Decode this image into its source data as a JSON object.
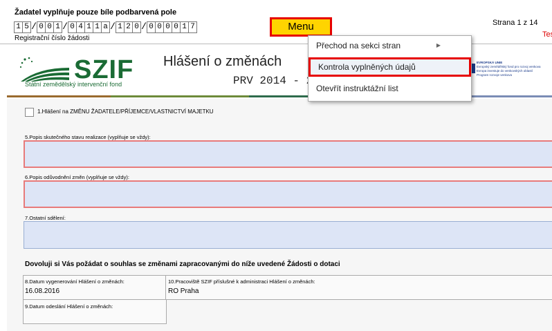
{
  "header": {
    "instruction": "Žadatel vyplňuje pouze bíle podbarvená pole",
    "reg_digits": [
      "1",
      "5",
      "/",
      "0",
      "0",
      "1",
      "/",
      "0",
      "4",
      "1",
      "1",
      "a",
      "/",
      "1",
      "2",
      "0",
      "/",
      "0",
      "0",
      "0",
      "0",
      "1",
      "7"
    ],
    "reg_label": "Registrační číslo žádosti",
    "menu_label": "Menu",
    "page_info": "Strana 1 z 14",
    "test_label": "Test"
  },
  "logo": {
    "name": "SZIF",
    "subtitle": "Státní zemědělský intervenční fond"
  },
  "form_title": "Hlášení o změnách",
  "form_subtitle": "PRV 2014 - 2",
  "eu_badge": {
    "line1": "EVROPSKÁ UNIE",
    "line2": "Evropský zemědělský fond pro rozvoj venkova",
    "line3": "Evropa investuje do venkovských oblastí",
    "line4": "Program rozvoje venkova"
  },
  "dropdown": {
    "items": [
      "Přechod na sekci stran",
      "Kontrola vyplněných údajů",
      "Otevřít instruktážní list"
    ]
  },
  "form": {
    "checkbox_label": "1.Hlášení na ZMĚNU ŽADATELE/PŘÍJEMCE/VLASTNICTVÍ MAJETKU",
    "field5_label": "5.Popis skutečného stavu realizace (vyplňuje se vždy):",
    "field6_label": "6.Popis odůvodnění změn (vyplňuje se vždy):",
    "field7_label": "7.Ostatní sdělení:",
    "request_text": "Dovoluji si Vás požádat o souhlas se změnami zapracovanými do níže uvedené Žádosti o dotaci",
    "field8_label": "8.Datum vygenerování Hlášení o změnách:",
    "field8_value": "16.08.2016",
    "field10_label": "10.Pracoviště SZIF příslušné k administraci Hlášení o změnách:",
    "field10_value": "RO Praha",
    "field9_label": "9.Datum odeslání Hlášení o změnách:"
  },
  "colors": {
    "menu_bg": "#ffd400",
    "highlight_border": "#e60000",
    "field_bg": "#dde5f6",
    "logo_green": "#1a6b34"
  }
}
